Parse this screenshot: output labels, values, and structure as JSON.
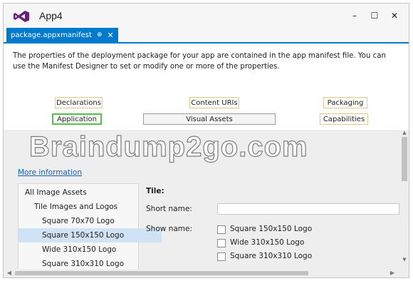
{
  "window": {
    "title": "App4",
    "minimize_label": "–",
    "maximize_label": "☐",
    "close_label": "✕"
  },
  "tab": {
    "label": "package.appxmanifest",
    "pin_label": "⊕",
    "close_label": "✕"
  },
  "description": "The properties of the deployment package for your app are contained in the app manifest file. You can use the Manifest Designer to set or modify one or more of the properties.",
  "nav_tabs": {
    "declarations": "Declarations",
    "content_uris": "Content URIs",
    "packaging": "Packaging",
    "application": "Application",
    "visual_assets": "Visual Assets",
    "capabilities": "Capabilities",
    "active": "application"
  },
  "watermark": "Braindump2go.com",
  "more_information": "More information",
  "asset_tree": {
    "items": [
      "All Image Assets",
      "Tile Images and Logos",
      "Square 70x70 Logo",
      "Square 150x150 Logo",
      "Wide 310x150 Logo",
      "Square 310x310 Logo"
    ],
    "selected": "Square 150x150 Logo"
  },
  "tile_form": {
    "heading": "Tile:",
    "short_name_label": "Short name:",
    "short_name_value": "",
    "show_name_label": "Show name:",
    "show_name_options": [
      {
        "label": "Square 150x150 Logo",
        "checked": false
      },
      {
        "label": "Wide 310x150 Logo",
        "checked": false
      },
      {
        "label": "Square 310x310 Logo",
        "checked": false
      }
    ]
  },
  "icons": [
    "visual-studio-logo-icon",
    "minimize-icon",
    "maximize-icon",
    "close-icon",
    "pin-icon",
    "tab-close-icon",
    "scroll-up-icon",
    "scroll-down-icon",
    "scroll-left-icon",
    "scroll-right-icon"
  ],
  "colors": {
    "accent": "#007acc",
    "logo": "#68217a",
    "active_tab_border": "#57c04a",
    "link": "#1a5fb4",
    "selection": "#cfe3f5"
  }
}
